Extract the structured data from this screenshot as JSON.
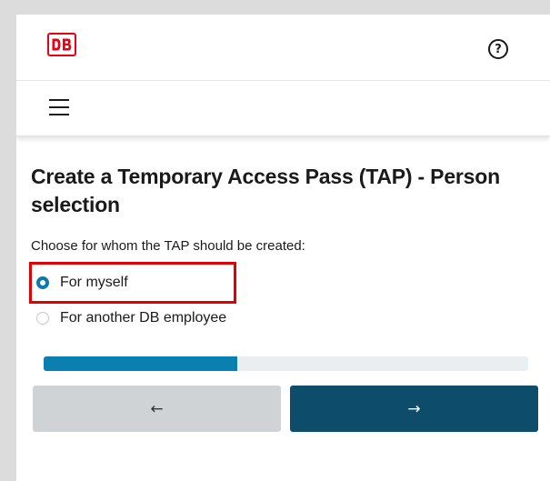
{
  "header": {
    "logo_text": "DB",
    "help_icon": "question-circle-icon",
    "help_glyph": "?"
  },
  "nav": {
    "menu_icon": "hamburger-menu-icon"
  },
  "main": {
    "title": "Create a Temporary Access Pass (TAP) - Person selection",
    "prompt": "Choose for whom the TAP should be created:",
    "options": [
      {
        "label": "For myself",
        "selected": true
      },
      {
        "label": "For another DB employee",
        "selected": false
      }
    ]
  },
  "progress": {
    "fraction": 0.4
  },
  "buttons": {
    "back_glyph": "←",
    "next_glyph": "→"
  },
  "colors": {
    "brand_red": "#ec0016",
    "accent_blue": "#0c7fb1",
    "primary_button": "#0e4c6b",
    "secondary_button": "#d0d3d6",
    "highlight_red": "#e30000"
  }
}
